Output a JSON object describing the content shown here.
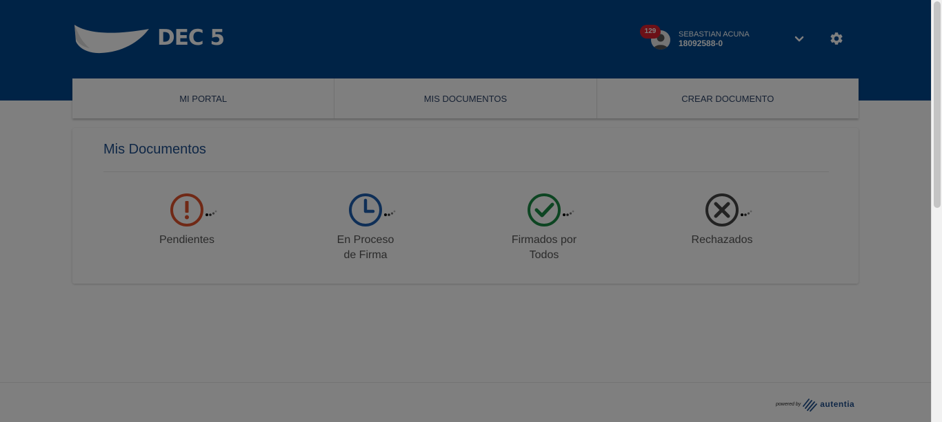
{
  "header": {
    "logo_text": "DEC 5",
    "brand_color": "#00478c",
    "notification_count": "129",
    "user_name": "SEBASTIAN ACUNA",
    "user_id": "18092588-0",
    "icons": {
      "logo": "dec-logo-icon",
      "avatar": "user-avatar-icon",
      "dropdown": "chevron-down-icon",
      "settings": "gear-icon"
    }
  },
  "nav": {
    "items": [
      {
        "label": "MI PORTAL"
      },
      {
        "label": "MIS DOCUMENTOS"
      },
      {
        "label": "CREAR DOCUMENTO"
      }
    ]
  },
  "main": {
    "title": "Mis Documentos",
    "statuses": [
      {
        "line1": "Pendientes",
        "line2": "",
        "icon": "exclamation-icon",
        "color": "#e0522d"
      },
      {
        "line1": "En Proceso",
        "line2": "de Firma",
        "icon": "clock-icon",
        "color": "#1f5fae"
      },
      {
        "line1": "Firmados por",
        "line2": "Todos",
        "icon": "checkmark-icon",
        "color": "#1b8a45"
      },
      {
        "line1": "Rechazados",
        "line2": "",
        "icon": "x-circle-icon",
        "color": "#444444"
      }
    ]
  },
  "footer": {
    "powered_by": "powered by",
    "brand": "autentia"
  },
  "overlay_color": "rgba(0,0,0,0.5)"
}
